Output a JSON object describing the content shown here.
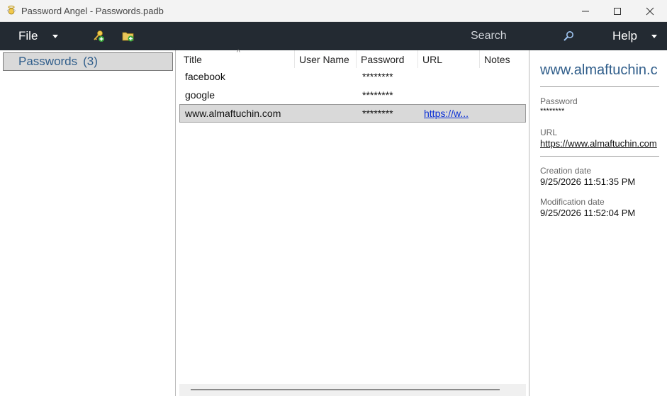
{
  "window": {
    "title": "Password Angel - Passwords.padb"
  },
  "toolbar": {
    "file_label": "File",
    "search_placeholder": "Search",
    "help_label": "Help"
  },
  "sidebar": {
    "items": [
      {
        "label": "Passwords",
        "count": "(3)"
      }
    ]
  },
  "table": {
    "columns": [
      "Title",
      "User Name",
      "Password",
      "URL",
      "Notes"
    ],
    "rows": [
      {
        "title": "facebook",
        "username": "",
        "password": "********",
        "url": "",
        "notes": ""
      },
      {
        "title": "google",
        "username": "",
        "password": "********",
        "url": "",
        "notes": ""
      },
      {
        "title": "www.almaftuchin.com",
        "username": "",
        "password": "********",
        "url": "https://w...",
        "notes": ""
      }
    ]
  },
  "detail": {
    "title": "www.almaftuchin.c",
    "password_label": "Password",
    "password_value": "********",
    "url_label": "URL",
    "url_value": "https://www.almaftuchin.com",
    "created_label": "Creation date",
    "created_value": "9/25/2026 11:51:35 PM",
    "modified_label": "Modification date",
    "modified_value": "9/25/2026 11:52:04 PM"
  },
  "colors": {
    "toolbar_bg": "#232a32",
    "accent_blue": "#2f5d8a",
    "link_blue": "#0a2fd6",
    "selection_bg": "#d9d9d9"
  },
  "icons": [
    "app-angel-icon",
    "add-password-icon",
    "add-folder-icon",
    "search-icon",
    "minimize-icon",
    "maximize-icon",
    "close-icon"
  ]
}
